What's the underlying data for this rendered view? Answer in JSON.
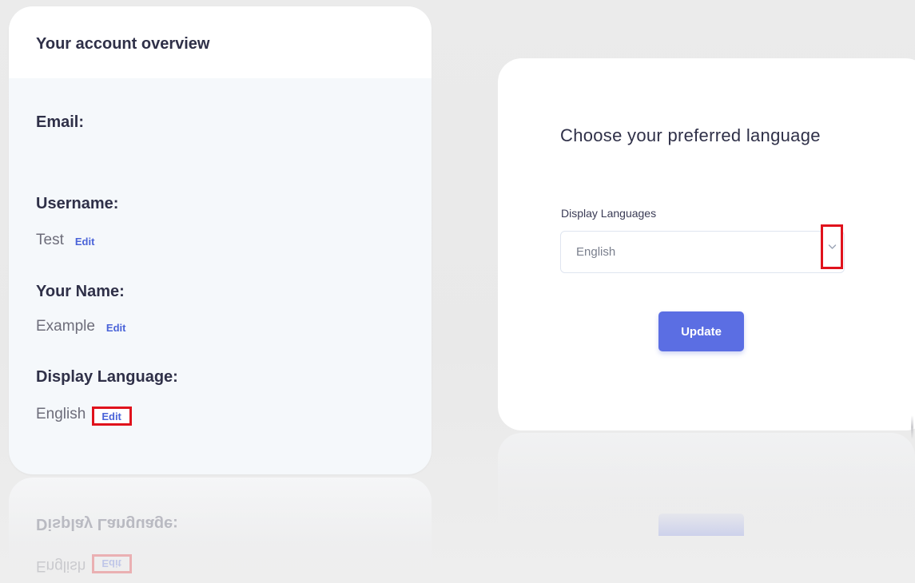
{
  "overview": {
    "title": "Your account overview",
    "email_label": "Email:",
    "email_value": "",
    "username_label": "Username:",
    "username_value": "Test",
    "name_label": "Your Name:",
    "name_value": "Example",
    "language_label": "Display Language:",
    "language_value": "English",
    "edit_label": "Edit"
  },
  "language_panel": {
    "heading": "Choose your preferred language",
    "select_label": "Display Languages",
    "selected_value": "English",
    "update_label": "Update"
  },
  "colors": {
    "accent": "#5b6ee3",
    "link": "#4a63d8",
    "highlight": "#e0121c"
  },
  "icons": {
    "dropdown": "chevron-down-icon"
  }
}
